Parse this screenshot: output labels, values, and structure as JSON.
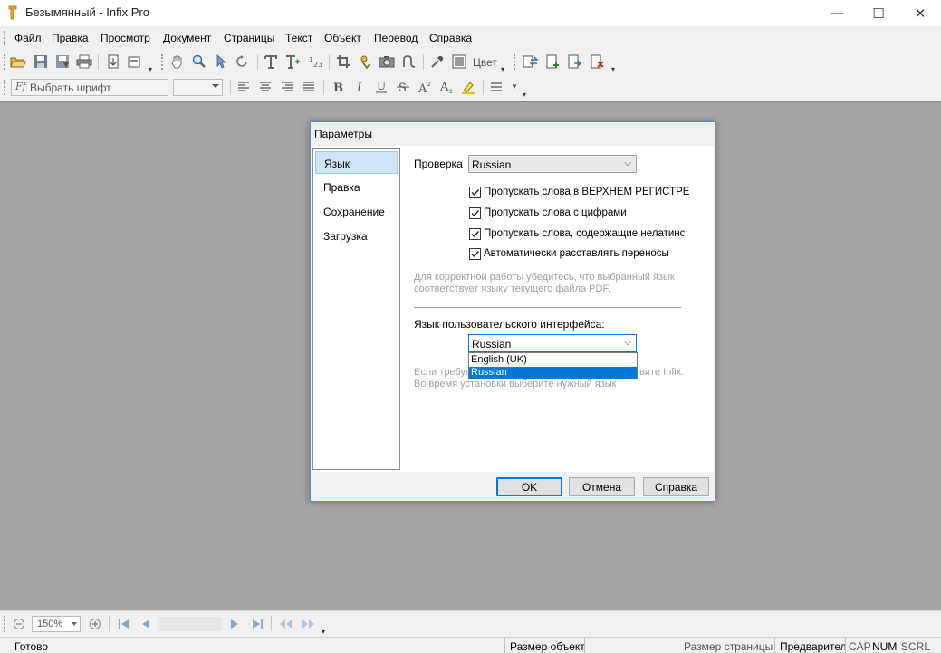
{
  "window": {
    "title": "Безымянный - Infix Pro",
    "minimize": "—",
    "maximize": "☐",
    "close": "✕"
  },
  "menu": [
    "Файл",
    "Правка",
    "Просмотр",
    "Документ",
    "Страницы",
    "Текст",
    "Объект",
    "Перевод",
    "Справка"
  ],
  "toolbar": {
    "color_label": "Цвет",
    "font_placeholder": "Выбрать шрифт",
    "font_icon": "Ff"
  },
  "dialog": {
    "title": "Параметры",
    "nav": [
      "Язык",
      "Правка",
      "Сохранение",
      "Загрузка"
    ],
    "spellcheck_label": "Проверка",
    "spellcheck_value": "Russian",
    "checkboxes": [
      {
        "label": "Пропускать слова в ВЕРХНЕМ РЕГИСТРЕ",
        "checked": true
      },
      {
        "label": "Пропускать слова с цифрами",
        "checked": true
      },
      {
        "label": "Пропускать слова, содержащие нелатинс",
        "checked": true
      },
      {
        "label": "Автоматически расставлять переносы",
        "checked": true
      }
    ],
    "hint1_line1": "Для корректной работы убедитесь, что выбранный язык",
    "hint1_line2": "соответствует языку текущего файла PDF.",
    "ui_lang_label": "Язык пользовательского интерфейса:",
    "ui_lang_value": "Russian",
    "ui_lang_options": [
      "English (UK)",
      "Russian"
    ],
    "hint2_line1_start": "Если требуе",
    "hint2_line1_end": "вите Infix.",
    "hint2_line2": "Во время установки выберите нужный язык",
    "ok": "OK",
    "cancel": "Отмена",
    "help": "Справка"
  },
  "bottom": {
    "zoom": "150%"
  },
  "status": {
    "ready": "Готово",
    "object_size": "Размер объект",
    "page_size": "Размер страницы",
    "preview": "Предварител",
    "cap": "CAP",
    "num": "NUM",
    "scrl": "SCRL"
  }
}
